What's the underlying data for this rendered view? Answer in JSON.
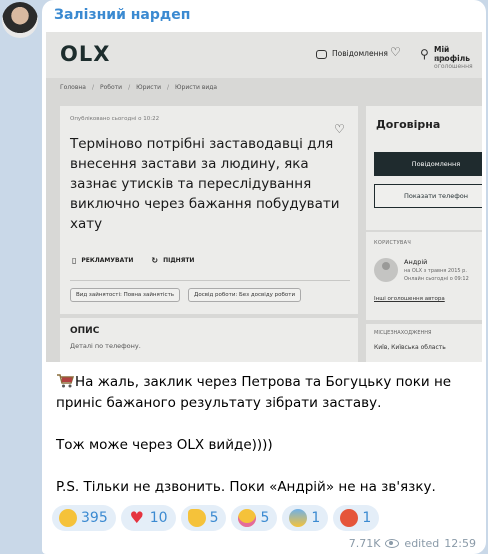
{
  "channel": {
    "name": "Залізний нардеп"
  },
  "olx": {
    "logo": "OLX",
    "header": {
      "messages": "Повідомлення",
      "profile": "Мій профіль",
      "profile_sub": "Ваш оголошення"
    },
    "breadcrumb": [
      "Головна",
      "Роботи",
      "Юристи",
      "Юристи вида"
    ],
    "published": "Опубліковано сьогодні о 10:22",
    "title": "Терміново потрібні заставодавці для внесення застави за людину, яка зазнає утисків та переслідування виключно через бажання побудувати хату",
    "promote": "РЕКЛАМУВАТИ",
    "raise": "ПІДНЯТИ",
    "tags": [
      "Вид зайнятості: Повна зайнятість",
      "Досвід роботи: Без досвіду роботи"
    ],
    "description_heading": "ОПИС",
    "description_text": "Деталі по телефону.",
    "price": "Договірна",
    "message_button": "Повідомлення",
    "phone_button": "Показати телефон",
    "user_heading": "Користувач",
    "user_name": "Андрій",
    "user_since": "на OLX з травня 2015 р.",
    "user_online": "Онлайн сьогодні о 09:12",
    "user_link": "Інші оголошення автора",
    "location_heading": "Місцезнаходження",
    "location_text": "Київ, Київська область"
  },
  "message": {
    "line1": "На жаль, заклик через Петрова та Богуцьку поки не приніс бажаного результату зібрати заставу.",
    "line2": "Тож може через OLX вийде))))",
    "line3": "P.S. Тільки не дзвонить. Поки «Андрій» не на зв'язку."
  },
  "reactions": [
    {
      "icon": "rofl-emoji-icon",
      "count": "395",
      "color": "#f5c23a"
    },
    {
      "icon": "heart-emoji-icon",
      "count": "10",
      "color": "#e5333f"
    },
    {
      "icon": "thumbs-up-emoji-icon",
      "count": "5",
      "color": "#f5c23a"
    },
    {
      "icon": "party-emoji-icon",
      "count": "5",
      "color": "#f5c23a"
    },
    {
      "icon": "scream-emoji-icon",
      "count": "1",
      "color": "#6fb0e8"
    },
    {
      "icon": "angry-emoji-icon",
      "count": "1",
      "color": "#e5553a"
    }
  ],
  "meta": {
    "views": "7.71K",
    "edited": "edited",
    "time": "12:59"
  }
}
